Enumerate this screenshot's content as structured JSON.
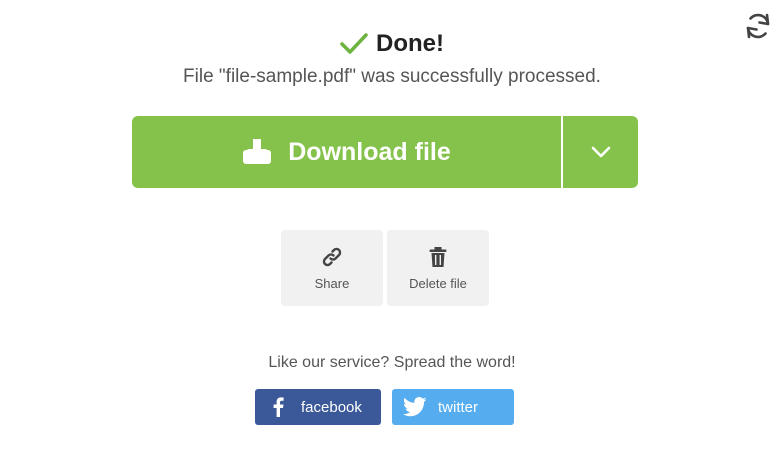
{
  "status": {
    "title": "Done!",
    "message": "File \"file-sample.pdf\" was successfully processed."
  },
  "download": {
    "label": "Download file"
  },
  "actions": [
    {
      "label": "Share",
      "icon": "link-icon"
    },
    {
      "label": "Delete file",
      "icon": "trash-icon"
    }
  ],
  "promo": {
    "text": "Like our service? Spread the word!"
  },
  "social": {
    "facebook_label": "facebook",
    "twitter_label": "twitter"
  },
  "colors": {
    "accent_green": "#84c24b",
    "check_green": "#6db33f",
    "facebook_blue": "#3b5998",
    "twitter_blue": "#55acee",
    "tile_bg": "#f1f1f1"
  }
}
